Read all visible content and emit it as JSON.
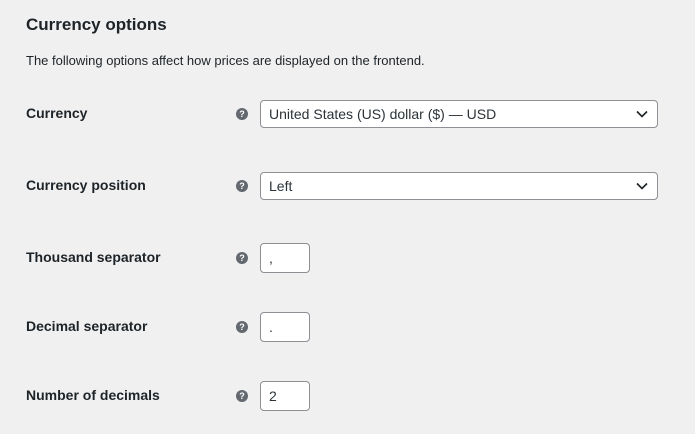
{
  "section": {
    "title": "Currency options",
    "description": "The following options affect how prices are displayed on the frontend."
  },
  "help_icon_glyph": "?",
  "fields": {
    "currency": {
      "label": "Currency",
      "value": "United States (US) dollar ($) — USD",
      "icon": "chevron-down-icon"
    },
    "currency_position": {
      "label": "Currency position",
      "value": "Left",
      "icon": "chevron-down-icon"
    },
    "thousand_separator": {
      "label": "Thousand separator",
      "value": ","
    },
    "decimal_separator": {
      "label": "Decimal separator",
      "value": "."
    },
    "number_of_decimals": {
      "label": "Number of decimals",
      "value": "2"
    }
  },
  "colors": {
    "background": "#f0f0f1",
    "text": "#1d2327",
    "help_icon": "#646970",
    "input_border": "#8c8f94"
  }
}
